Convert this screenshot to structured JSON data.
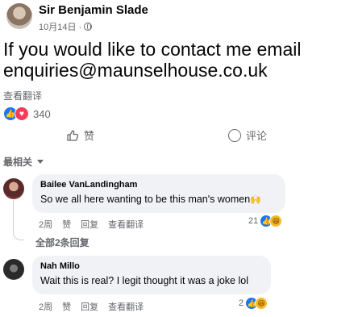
{
  "post": {
    "author": "Sir Benjamin Slade",
    "date": "10月14日 ·",
    "text": "If you would like to contact me email enquiries@maunselhouse.co.uk",
    "translate": "查看翻译",
    "reaction_count": "340",
    "reactions": [
      "like-reaction-icon",
      "love-reaction-icon"
    ],
    "actions": {
      "like": "赞",
      "comment": "评论"
    }
  },
  "comments_filter": "最相关",
  "comments": [
    {
      "author": "Bailee VanLandingham",
      "text": "So we all here wanting to be this man's women",
      "emoji": "🙌",
      "time": "2周",
      "like": "赞",
      "reply": "回复",
      "translate": "查看翻译",
      "reaction_count": "21",
      "replies_label": "全部2条回复"
    },
    {
      "author": "Nah Millo",
      "text": "Wait this is real? I legit thought it was a joke lol",
      "time": "2周",
      "like": "赞",
      "reply": "回复",
      "translate": "查看翻译",
      "reaction_count": "2"
    }
  ],
  "colors": {
    "accent": "#1877f2",
    "love": "#f33e58",
    "bubble": "#f0f2f5",
    "muted": "#65676b"
  }
}
